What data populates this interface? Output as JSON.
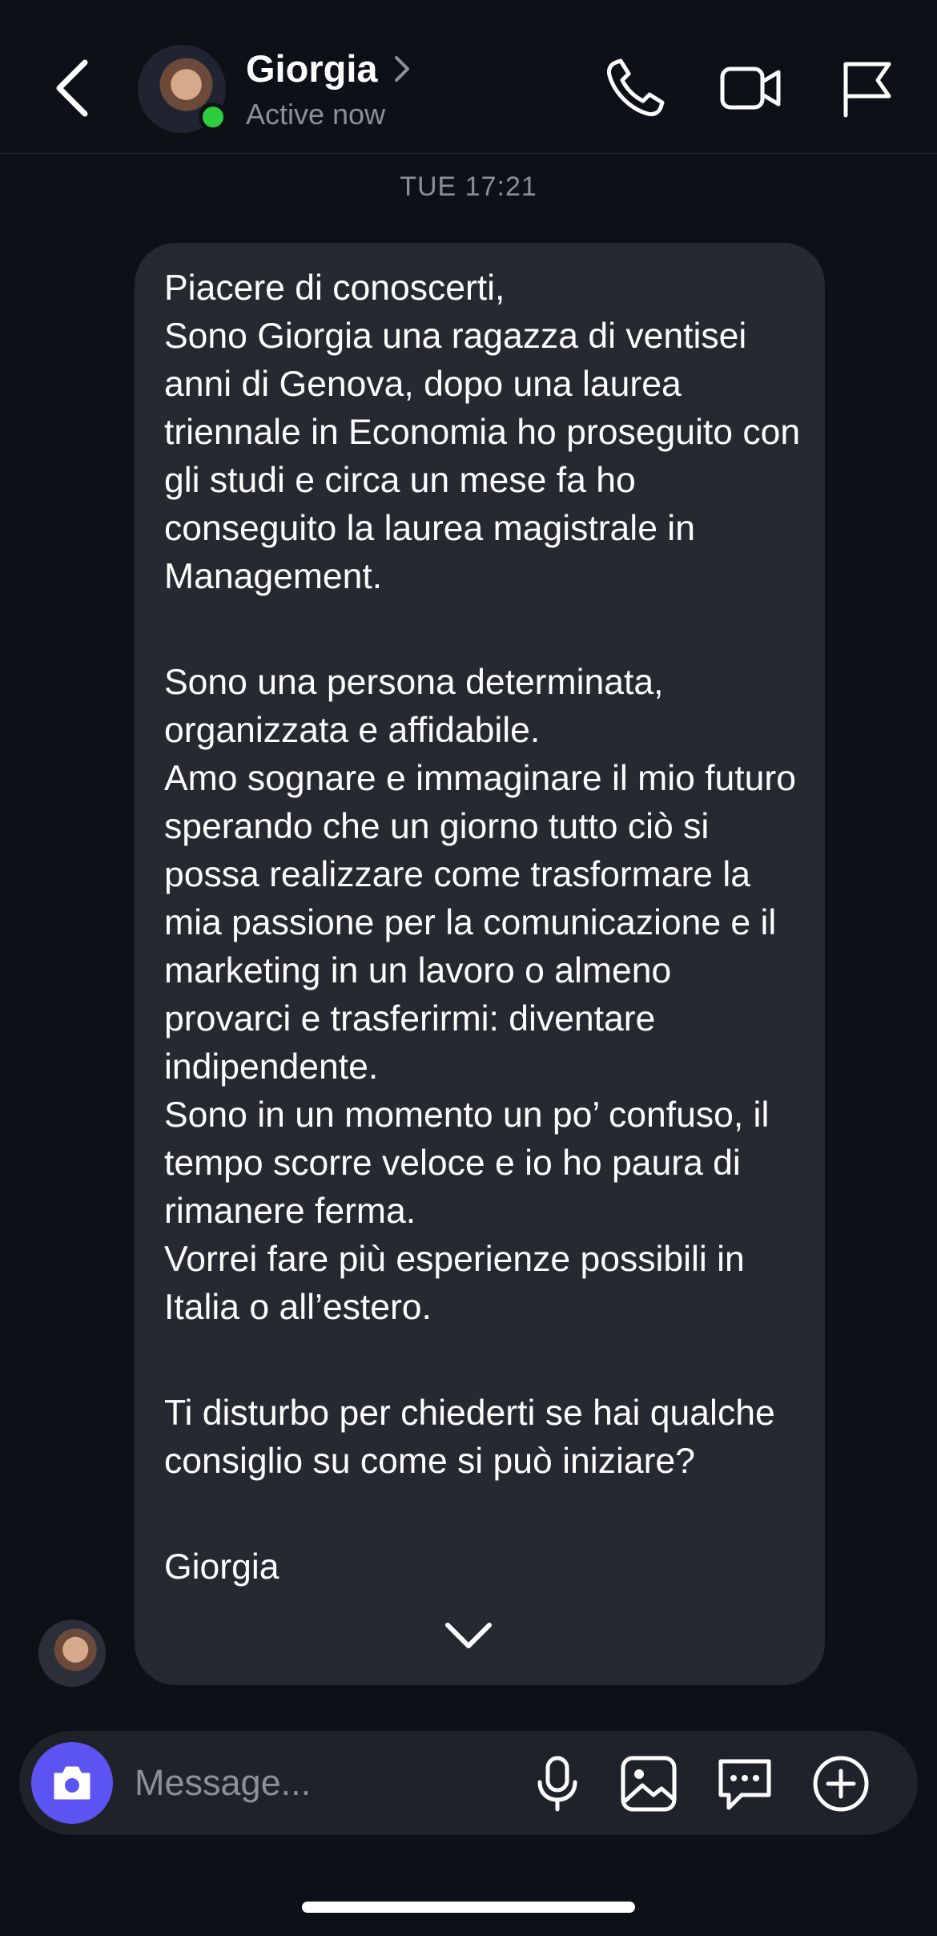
{
  "header": {
    "contact_name": "Giorgia",
    "status": "Active now"
  },
  "thread": {
    "timestamp": "TUE 17:21",
    "message": {
      "paragraph_1": "Piacere di conoscerti,\nSono Giorgia una ragazza di ventisei anni di Genova, dopo una laurea triennale in Economia ho proseguito con gli studi e circa un mese fa ho conseguito la laurea magistrale in Management.",
      "paragraph_2": "Sono una persona determinata, organizzata e affidabile.\nAmo sognare e immaginare il mio futuro sperando che un giorno tutto ciò si possa realizzare come trasformare la mia passione per la comunicazione e il marketing in un lavoro o almeno provarci e trasferirmi: diventare  indipendente.\nSono in un momento un po’ confuso, il tempo scorre veloce e io ho paura di rimanere ferma.\nVorrei fare più esperienze possibili in Italia o all’estero.",
      "paragraph_3": "Ti disturbo per chiederti se hai qualche consiglio su come  si può iniziare?",
      "signature": "Giorgia"
    }
  },
  "composer": {
    "placeholder": "Message..."
  },
  "colors": {
    "background": "#0d1117",
    "bubble": "#262a30",
    "accent": "#5b54f2",
    "online": "#2ecc3f",
    "muted_text": "#8a8f98"
  },
  "icons": [
    "back-chevron-icon",
    "phone-icon",
    "video-camera-icon",
    "flag-icon",
    "chevron-down-icon",
    "camera-icon",
    "microphone-icon",
    "image-icon",
    "sticker-icon",
    "plus-circle-icon"
  ]
}
